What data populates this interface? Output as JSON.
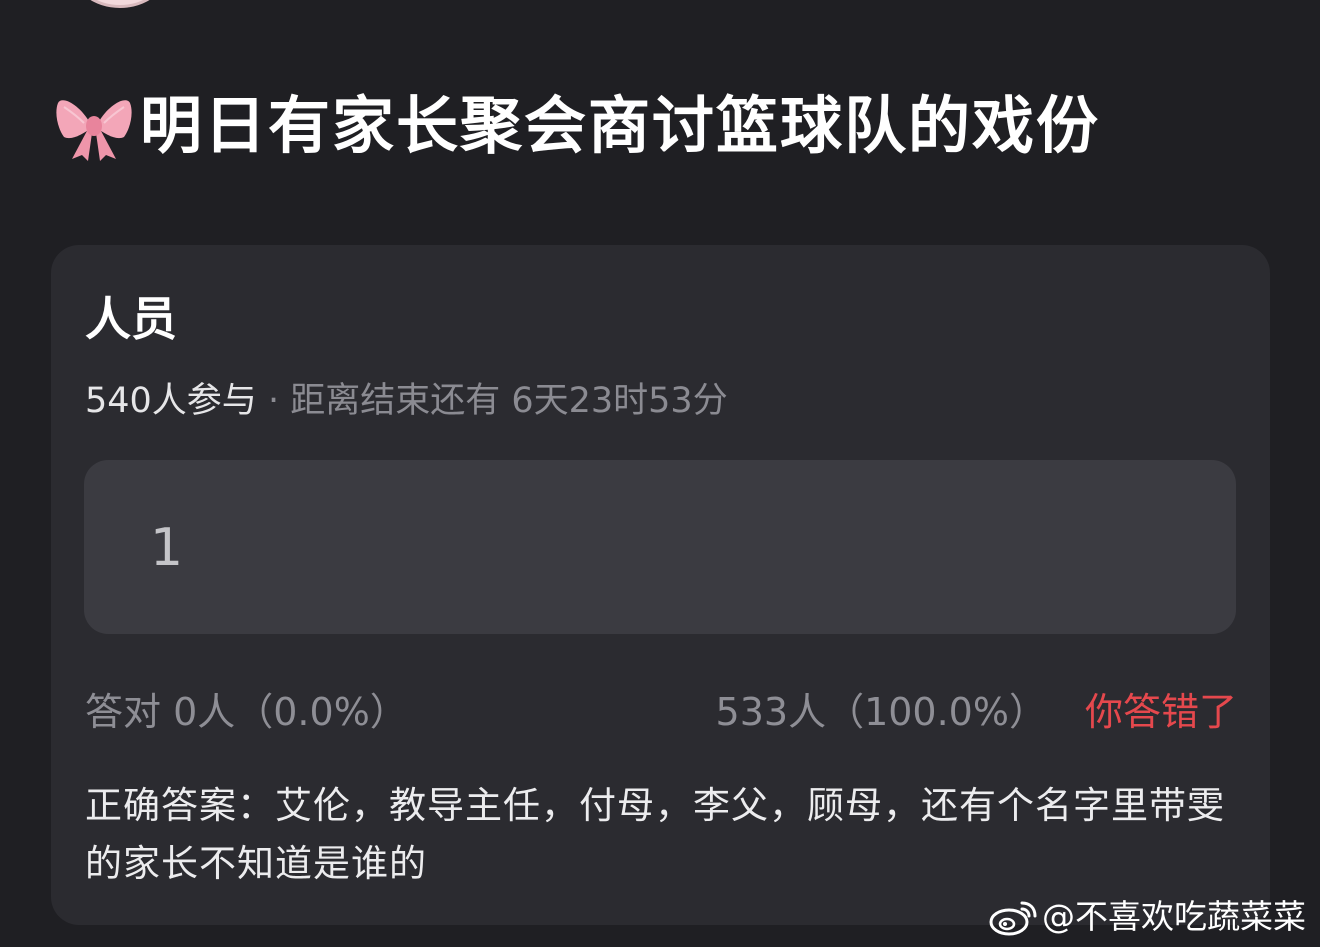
{
  "post": {
    "title_emoji_icon": "ribbon-bow-icon",
    "title": "明日有家长聚会商讨篮球队的戏份"
  },
  "quiz": {
    "question": "人员",
    "participants": "540人参与",
    "separator": "·",
    "deadline": "距离结束还有 6天23时53分",
    "answer_value": "1",
    "correct_stats": "答对  0人（0.0%）",
    "wrong_stats": "533人（100.0%）",
    "verdict": "你答错了",
    "correct_answer": "正确答案：艾伦，教导主任，付母，李父，顾母，还有个名字里带雯的家长不知道是谁的"
  },
  "watermark": {
    "icon": "weibo-icon",
    "text": "@不喜欢吃蔬菜菜"
  },
  "colors": {
    "background": "#1f1f23",
    "card": "#2b2b30",
    "answer_box": "#3b3b41",
    "verdict_red": "#e5484d",
    "muted_text": "#8e8e95"
  }
}
